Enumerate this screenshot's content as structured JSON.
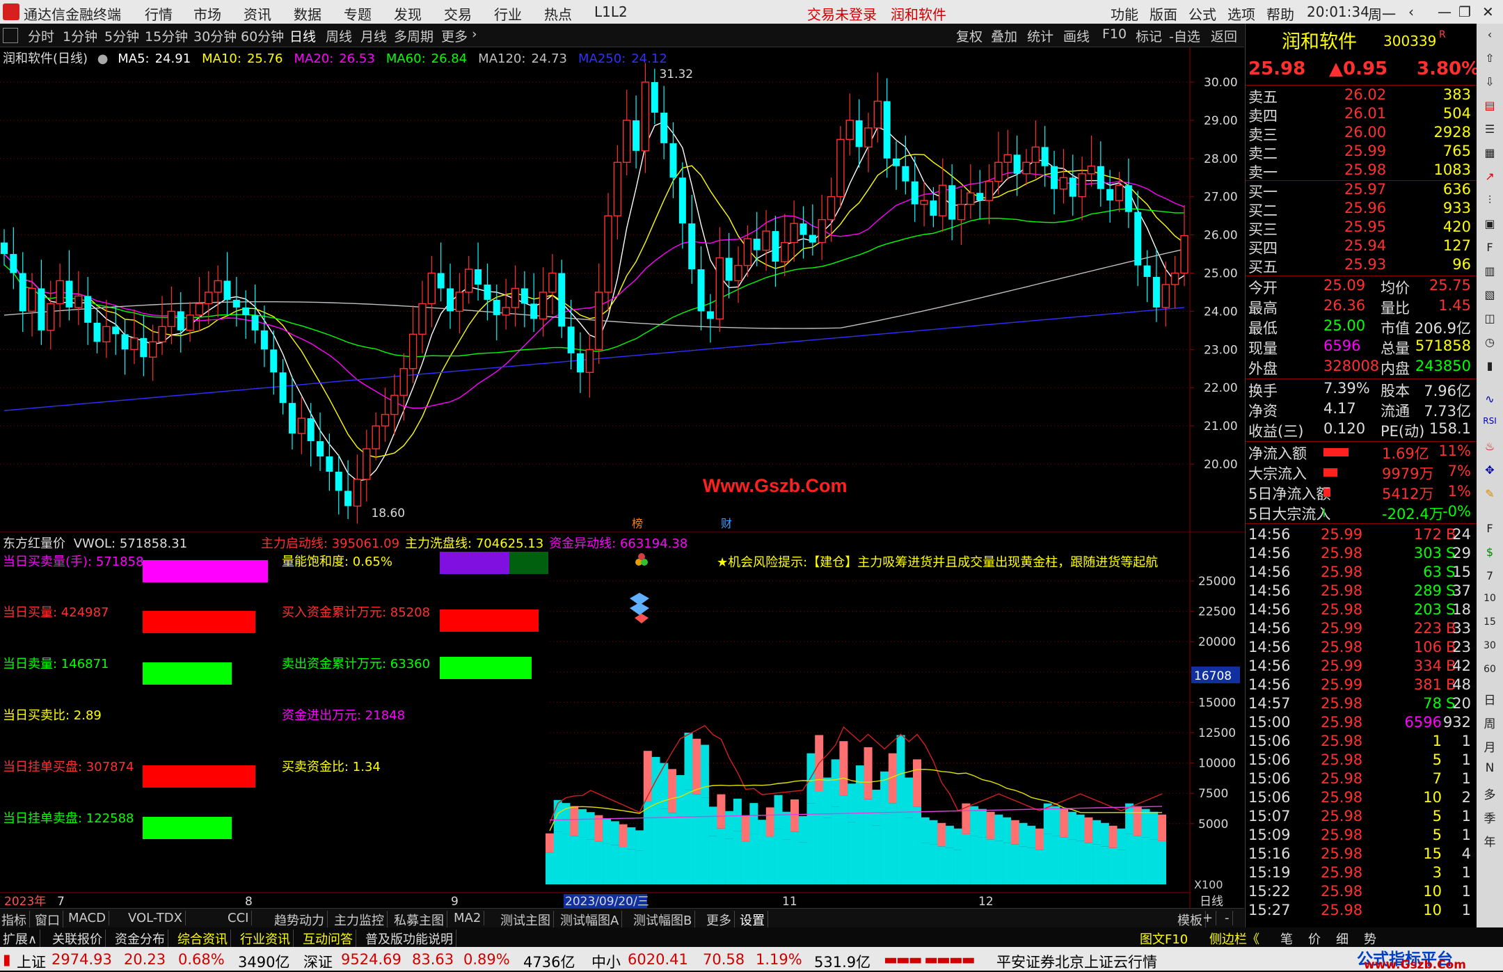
{
  "titlebar": {
    "app_name": "通达信金融终端",
    "menus": [
      "行情",
      "市场",
      "资讯",
      "数据",
      "专题",
      "发现",
      "交易",
      "行业",
      "热点",
      "L1L2"
    ],
    "trade_status": "交易未登录",
    "stock_name": "润和软件",
    "right_menus": [
      "功能",
      "版面",
      "公式",
      "选项",
      "帮助"
    ],
    "time": "20:01:34",
    "weekday": "周一"
  },
  "toolbar": {
    "periods": [
      "分时",
      "1分钟",
      "5分钟",
      "15分钟",
      "30分钟",
      "60分钟",
      "日线",
      "周线",
      "月线",
      "多周期",
      "更多"
    ],
    "active_period": "日线",
    "right_buttons": [
      "复权",
      "叠加",
      "统计",
      "画线",
      "F10",
      "标记",
      "-自选",
      "返回"
    ]
  },
  "main_legend": {
    "title": "润和软件(日线)",
    "ma": [
      {
        "label": "MA5:",
        "value": "24.91",
        "color": "#ffffff"
      },
      {
        "label": "MA10:",
        "value": "25.76",
        "color": "#ffff00"
      },
      {
        "label": "MA20:",
        "value": "26.53",
        "color": "#ff00ff"
      },
      {
        "label": "MA60:",
        "value": "26.84",
        "color": "#00ff00"
      },
      {
        "label": "MA120:",
        "value": "24.73",
        "color": "#c0c0c0"
      },
      {
        "label": "MA250:",
        "value": "24.12",
        "color": "#3030ff"
      }
    ]
  },
  "main_annotations": {
    "high": "31.32",
    "low": "18.60",
    "watermark": "Www.Gszb.Com",
    "tag1": "榜",
    "tag2": "财"
  },
  "chart_data": [
    {
      "type": "candlestick",
      "name": "润和软件(日线)",
      "ylim": [
        17.5,
        31.5
      ],
      "y_ticks": [
        "30.00",
        "29.00",
        "28.00",
        "27.00",
        "26.00",
        "25.00",
        "24.00",
        "23.00",
        "22.00",
        "21.00",
        "20.00"
      ],
      "close": [
        25.5,
        25.0,
        24.0,
        24.6,
        23.5,
        24.2,
        24.8,
        24.1,
        24.4,
        23.7,
        23.2,
        23.6,
        23.4,
        23.0,
        23.3,
        22.8,
        23.2,
        23.6,
        24.0,
        23.5,
        23.9,
        24.2,
        24.5,
        24.8,
        24.3,
        24.1,
        23.9,
        23.5,
        23.0,
        22.4,
        21.6,
        20.8,
        21.2,
        20.6,
        20.2,
        19.8,
        19.3,
        18.9,
        19.6,
        20.4,
        21.0,
        21.3,
        21.8,
        22.5,
        23.4,
        24.2,
        25.0,
        24.6,
        24.0,
        24.5,
        25.1,
        24.7,
        24.3,
        23.9,
        24.1,
        24.6,
        24.2,
        23.8,
        24.5,
        25.0,
        23.6,
        22.9,
        22.4,
        23.0,
        24.5,
        26.5,
        27.9,
        29.0,
        28.2,
        30.0,
        29.2,
        28.4,
        27.5,
        26.3,
        25.1,
        24.0,
        23.8,
        25.4,
        24.8,
        25.2,
        25.9,
        25.6,
        26.1,
        25.3,
        25.8,
        26.3,
        26.0,
        25.8,
        26.4,
        27.0,
        28.5,
        29.0,
        28.3,
        28.8,
        29.5,
        28.0,
        27.8,
        27.4,
        26.8,
        26.9,
        26.5,
        27.3,
        26.4,
        26.8,
        27.1,
        26.9,
        27.4,
        27.9,
        28.1,
        27.6,
        27.9,
        28.3,
        27.8,
        27.2,
        27.5,
        27.0,
        27.6,
        27.8,
        27.2,
        26.9,
        27.3,
        26.6,
        25.2,
        24.9,
        24.1,
        24.7,
        25.0,
        25.98
      ],
      "ma_lines": [
        "MA5",
        "MA10",
        "MA20",
        "MA60",
        "MA120",
        "MA250"
      ]
    },
    {
      "type": "bar",
      "name": "VWOL",
      "y_ticks": [
        "25000",
        "22500",
        "20000",
        "17500",
        "15000",
        "12500",
        "10000",
        "7500",
        "5000"
      ],
      "ylim": [
        0,
        26000
      ],
      "current_label": "16708",
      "scale_label": "X100",
      "x_labels": [
        "2023年",
        "7",
        "8",
        "9",
        "2023/09/20/三",
        "11",
        "12",
        "日线"
      ]
    }
  ],
  "lower_legend": {
    "title": "东方红量价",
    "vwol": "VWOL: 571858.31",
    "items": [
      {
        "label": "主力启动线: ",
        "value": "395061.09",
        "color": "#ff3030"
      },
      {
        "label": "主力洗盘线: ",
        "value": "704625.13",
        "color": "#ffff00"
      },
      {
        "label": "资金异动线: ",
        "value": "663194.38",
        "color": "#ff00ff"
      }
    ]
  },
  "indicators_left": [
    {
      "label": "当日买卖量(手): 571858",
      "color": "#ff00ff",
      "bar": "#ff00ff",
      "w": 180
    },
    {
      "label": "当日买量: 424987",
      "color": "#ff3030",
      "bar": "#ff0000",
      "w": 162
    },
    {
      "label": "当日卖量: 146871",
      "color": "#00ff00",
      "bar": "#00ff00",
      "w": 128
    },
    {
      "label": "当日买卖比: 2.89",
      "color": "#ffff00",
      "bar": "",
      "w": 0
    },
    {
      "label": "当日挂单买盘: 307874",
      "color": "#ff3030",
      "bar": "#ff0000",
      "w": 162
    },
    {
      "label": "当日挂单卖盘: 122588",
      "color": "#00ff00",
      "bar": "#00ff00",
      "w": 128
    }
  ],
  "indicators_mid": [
    {
      "label": "量能饱和度: 0.65%",
      "color": "#ffff00"
    },
    {
      "label": "买入资金累计万元: 85208",
      "color": "#ff3030"
    },
    {
      "label": "卖出资金累计万元: 63360",
      "color": "#00ff00"
    },
    {
      "label": "资金进出万元: 21848",
      "color": "#ff00ff"
    },
    {
      "label": "买卖资金比: 1.34",
      "color": "#ffff00"
    }
  ],
  "tip": "★机会风险提示:【建仓】主力吸筹进货并且成交量出现黄金柱，跟随进货等起航",
  "quote": {
    "name": "润和软件",
    "code": "300339",
    "flag": "R",
    "price": "25.98",
    "change": "▲0.95",
    "pct": "3.80%",
    "asks": [
      [
        "卖五",
        "26.02",
        "383"
      ],
      [
        "卖四",
        "26.01",
        "504"
      ],
      [
        "卖三",
        "26.00",
        "2928"
      ],
      [
        "卖二",
        "25.99",
        "765"
      ],
      [
        "卖一",
        "25.98",
        "1083"
      ]
    ],
    "bids": [
      [
        "买一",
        "25.97",
        "636"
      ],
      [
        "买二",
        "25.96",
        "933"
      ],
      [
        "买三",
        "25.95",
        "420"
      ],
      [
        "买四",
        "25.94",
        "127"
      ],
      [
        "买五",
        "25.93",
        "96"
      ]
    ],
    "stats": [
      [
        "今开",
        "25.09",
        "均价",
        "25.75"
      ],
      [
        "最高",
        "26.36",
        "量比",
        "1.45"
      ],
      [
        "最低",
        "25.00",
        "市值",
        "206.9亿"
      ],
      [
        "现量",
        "6596",
        "总量",
        "571858"
      ],
      [
        "外盘",
        "328008",
        "内盘",
        "243850"
      ]
    ],
    "fin": [
      [
        "换手",
        "7.39%",
        "股本",
        "7.96亿"
      ],
      [
        "净资",
        "4.17",
        "流通",
        "7.73亿"
      ],
      [
        "收益(三)",
        "0.120",
        "PE(动)",
        "158.1"
      ]
    ],
    "flows": [
      [
        "净流入额",
        "1.69亿",
        "11%"
      ],
      [
        "大宗流入",
        "9979万",
        "7%"
      ],
      [
        "5日净流入额",
        "5412万",
        "1%"
      ],
      [
        "5日大宗流入",
        "-202.4万",
        "-0%"
      ]
    ],
    "ticks": [
      [
        "14:56",
        "25.99",
        "172",
        "B",
        "24"
      ],
      [
        "14:56",
        "25.98",
        "303",
        "S",
        "29"
      ],
      [
        "14:56",
        "25.98",
        "63",
        "S",
        "15"
      ],
      [
        "14:56",
        "25.98",
        "289",
        "S",
        "37"
      ],
      [
        "14:56",
        "25.98",
        "203",
        "S",
        "18"
      ],
      [
        "14:56",
        "25.99",
        "223",
        "B",
        "33"
      ],
      [
        "14:56",
        "25.98",
        "106",
        "B",
        "23"
      ],
      [
        "14:56",
        "25.99",
        "334",
        "B",
        "42"
      ],
      [
        "14:56",
        "25.99",
        "381",
        "B",
        "48"
      ],
      [
        "14:57",
        "25.98",
        "78",
        "S",
        "20"
      ],
      [
        "15:00",
        "25.98",
        "6596",
        "",
        "932"
      ],
      [
        "15:06",
        "25.98",
        "1",
        "",
        "1"
      ],
      [
        "15:06",
        "25.98",
        "5",
        "",
        "1"
      ],
      [
        "15:06",
        "25.98",
        "7",
        "",
        "1"
      ],
      [
        "15:06",
        "25.98",
        "10",
        "",
        "2"
      ],
      [
        "15:07",
        "25.98",
        "5",
        "",
        "1"
      ],
      [
        "15:09",
        "25.98",
        "5",
        "",
        "1"
      ],
      [
        "15:16",
        "25.98",
        "15",
        "",
        "4"
      ],
      [
        "15:19",
        "25.98",
        "3",
        "",
        "1"
      ],
      [
        "15:22",
        "25.98",
        "10",
        "",
        "1"
      ],
      [
        "15:27",
        "25.98",
        "10",
        "",
        "1"
      ]
    ]
  },
  "sidebar_labels": [
    "日",
    "周",
    "月",
    "N",
    "多",
    "季",
    "年"
  ],
  "tabs": [
    "指标",
    "窗口",
    "MACD",
    "VOL-TDX",
    "CCI",
    "趋势动力",
    "主力监控",
    "私募主图",
    "MA2",
    "测试主图",
    "测试幅图A",
    "测试幅图B",
    "更多",
    "设置"
  ],
  "tabs_right": [
    "模板",
    "+",
    "-"
  ],
  "tabs2": [
    "扩展∧",
    "关联报价",
    "资金分布",
    "综合资讯",
    "行业资讯",
    "互动问答",
    "普及版功能说明"
  ],
  "tabs2_right": [
    "图文F10",
    "侧边栏《",
    "笔",
    "价",
    "细",
    "势"
  ],
  "status": {
    "sh_label": "上证",
    "sh": "2974.93",
    "sh_chg": "20.23",
    "sh_pct": "0.68%",
    "sh_amt": "3490亿",
    "sz_label": "深证",
    "sz": "9524.69",
    "sz_chg": "83.63",
    "sz_pct": "0.89%",
    "sz_amt": "4736亿",
    "zx_label": "中小",
    "zx": "6020.41",
    "zx_chg": "70.58",
    "zx_pct": "1.19%",
    "zx_amt": "531.9亿",
    "server": "平安证券北京上证云行情",
    "brand": "公式指标平台",
    "brand_url": "www.Gszb.Com"
  }
}
